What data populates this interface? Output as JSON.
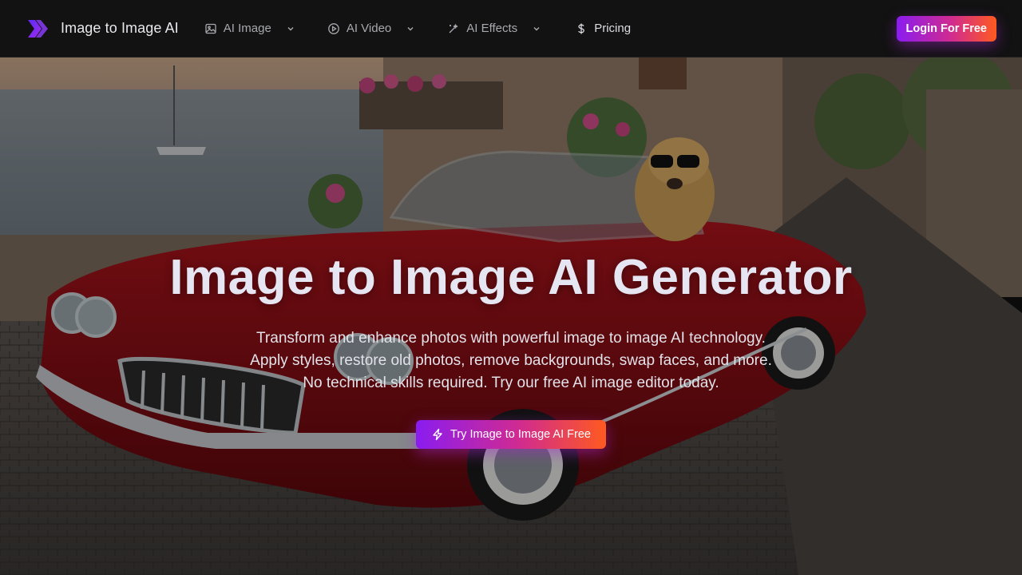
{
  "brand": {
    "name": "Image to Image AI",
    "logo_icon": "chevron-logo-icon"
  },
  "nav": {
    "items": [
      {
        "label": "AI Image",
        "icon": "image-icon",
        "has_dropdown": true
      },
      {
        "label": "AI Video",
        "icon": "play-circle-icon",
        "has_dropdown": true
      },
      {
        "label": "AI Effects",
        "icon": "magic-wand-icon",
        "has_dropdown": true
      },
      {
        "label": "Pricing",
        "icon": "dollar-icon",
        "has_dropdown": false
      }
    ]
  },
  "header": {
    "login_label": "Login For Free"
  },
  "hero": {
    "title": "Image to Image AI Generator",
    "subtitle_lines": [
      "Transform and enhance photos with powerful image to image AI technology.",
      "Apply styles, restore old photos, remove backgrounds, swap faces, and more.",
      "No technical skills required. Try our free AI image editor today."
    ],
    "cta_label": "Try Image to Image AI Free",
    "cta_icon": "lightning-icon",
    "background": "red convertible with golden retriever in sunglasses on cobblestone street by the sea"
  },
  "colors": {
    "gradient_start": "#8a1cf0",
    "gradient_mid": "#d12b8f",
    "gradient_end": "#ff5a1f",
    "header_bg": "#121212"
  }
}
